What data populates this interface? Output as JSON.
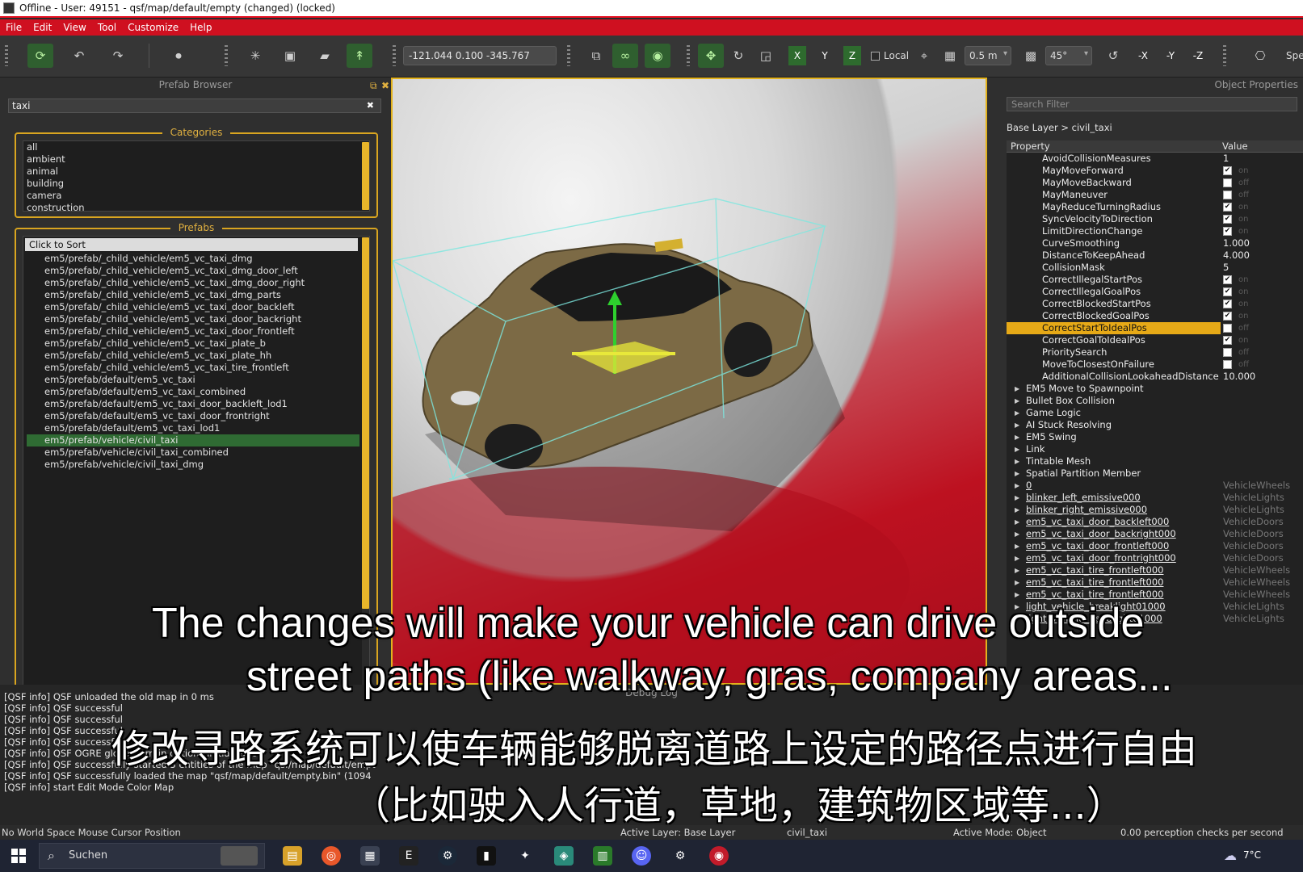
{
  "window": {
    "title": "Offline - User: 49151 - qsf/map/default/empty (changed) (locked)"
  },
  "menu": [
    "File",
    "Edit",
    "View",
    "Tool",
    "Customize",
    "Help"
  ],
  "toolbar": {
    "coordinates": "-121.044 0.100 -345.767",
    "axis_x": "X",
    "axis_y": "Y",
    "axis_z": "Z",
    "local_label": "Local",
    "grid_size": "0.5 m",
    "angle": "45°",
    "neg_x": "-X",
    "neg_y": "-Y",
    "neg_z": "-Z",
    "overflow_label": "Spe"
  },
  "prefab_browser": {
    "title": "Prefab Browser",
    "search_value": "taxi",
    "categories_title": "Categories",
    "categories": [
      "all",
      "ambient",
      "animal",
      "building",
      "camera",
      "construction"
    ],
    "prefabs_title": "Prefabs",
    "sort_label": "Click to Sort",
    "prefabs": [
      "em5/prefab/_child_vehicle/em5_vc_taxi_dmg",
      "em5/prefab/_child_vehicle/em5_vc_taxi_dmg_door_left",
      "em5/prefab/_child_vehicle/em5_vc_taxi_dmg_door_right",
      "em5/prefab/_child_vehicle/em5_vc_taxi_dmg_parts",
      "em5/prefab/_child_vehicle/em5_vc_taxi_door_backleft",
      "em5/prefab/_child_vehicle/em5_vc_taxi_door_backright",
      "em5/prefab/_child_vehicle/em5_vc_taxi_door_frontleft",
      "em5/prefab/_child_vehicle/em5_vc_taxi_plate_b",
      "em5/prefab/_child_vehicle/em5_vc_taxi_plate_hh",
      "em5/prefab/_child_vehicle/em5_vc_taxi_tire_frontleft",
      "em5/prefab/default/em5_vc_taxi",
      "em5/prefab/default/em5_vc_taxi_combined",
      "em5/prefab/default/em5_vc_taxi_door_backleft_lod1",
      "em5/prefab/default/em5_vc_taxi_door_frontright",
      "em5/prefab/default/em5_vc_taxi_lod1",
      "em5/prefab/vehicle/civil_taxi",
      "em5/prefab/vehicle/civil_taxi_combined",
      "em5/prefab/vehicle/civil_taxi_dmg"
    ],
    "selected_prefab": "em5/prefab/vehicle/civil_taxi"
  },
  "object_properties": {
    "title": "Object Properties",
    "search_placeholder": "Search Filter",
    "breadcrumb": "Base Layer > civil_taxi",
    "col_property": "Property",
    "col_value": "Value",
    "rows": [
      {
        "name": "AvoidCollisionMeasures",
        "value": "1"
      },
      {
        "name": "MayMoveForward",
        "check": true,
        "state": "on"
      },
      {
        "name": "MayMoveBackward",
        "check": false,
        "state": "off"
      },
      {
        "name": "MayManeuver",
        "check": false,
        "state": "off"
      },
      {
        "name": "MayReduceTurningRadius",
        "check": true,
        "state": "on"
      },
      {
        "name": "SyncVelocityToDirection",
        "check": true,
        "state": "on"
      },
      {
        "name": "LimitDirectionChange",
        "check": true,
        "state": "on"
      },
      {
        "name": "CurveSmoothing",
        "value": "1.000"
      },
      {
        "name": "DistanceToKeepAhead",
        "value": "4.000"
      },
      {
        "name": "CollisionMask",
        "value": "5"
      },
      {
        "name": "CorrectIllegalStartPos",
        "check": true,
        "state": "on"
      },
      {
        "name": "CorrectIllegalGoalPos",
        "check": true,
        "state": "on"
      },
      {
        "name": "CorrectBlockedStartPos",
        "check": true,
        "state": "on"
      },
      {
        "name": "CorrectBlockedGoalPos",
        "check": true,
        "state": "on"
      },
      {
        "name": "CorrectStartToIdealPos",
        "check": false,
        "state": "off",
        "selected": true
      },
      {
        "name": "CorrectGoalToIdealPos",
        "check": true,
        "state": "on"
      },
      {
        "name": "PrioritySearch",
        "check": false,
        "state": "off"
      },
      {
        "name": "MoveToClosestOnFailure",
        "check": false,
        "state": "off"
      },
      {
        "name": "AdditionalCollisionLookaheadDistance",
        "value": "10.000"
      }
    ],
    "sections": [
      "EM5 Move to Spawnpoint",
      "Bullet Box Collision",
      "Game Logic",
      "AI Stuck Resolving",
      "EM5 Swing",
      "Link",
      "Tintable Mesh",
      "Spatial Partition Member"
    ],
    "children": [
      {
        "name": "0",
        "type": "VehicleWheels"
      },
      {
        "name": "blinker_left_emissive000",
        "type": "VehicleLights"
      },
      {
        "name": "blinker_right_emissive000",
        "type": "VehicleLights"
      },
      {
        "name": "em5_vc_taxi_door_backleft000",
        "type": "VehicleDoors"
      },
      {
        "name": "em5_vc_taxi_door_backright000",
        "type": "VehicleDoors"
      },
      {
        "name": "em5_vc_taxi_door_frontleft000",
        "type": "VehicleDoors"
      },
      {
        "name": "em5_vc_taxi_door_frontright000",
        "type": "VehicleDoors"
      },
      {
        "name": "em5_vc_taxi_tire_frontleft000",
        "type": "VehicleWheels"
      },
      {
        "name": "em5_vc_taxi_tire_frontleft000",
        "type": "VehicleWheels"
      },
      {
        "name": "em5_vc_taxi_tire_frontleft000",
        "type": "VehicleWheels"
      },
      {
        "name": "light_vehicle_breaklight01000",
        "type": "VehicleLights"
      },
      {
        "name": "light_vehicle_headlight01000",
        "type": "VehicleLights"
      }
    ]
  },
  "debug_log": {
    "title": "Debug Log",
    "lines": [
      "[QSF info] QSF unloaded the old map in 0 ms",
      "[QSF info] QSF successful",
      "[QSF info] QSF successful",
      "[QSF info] QSF successful",
      "[QSF info] QSF successful",
      "[QSF info] QSF OGRE global terrain options initialization",
      "[QSF info] QSF successfully started 3 entities of the map \"qsf/map/default/empt",
      "[QSF info] QSF successfully loaded the map \"qsf/map/default/empty.bin\" (1094",
      "[QSF info] start Edit Mode Color Map"
    ]
  },
  "status": {
    "mouse": "No World Space Mouse Cursor Position",
    "layer": "Active Layer: Base Layer",
    "object": "civil_taxi",
    "mode": "Active Mode: Object",
    "perception": "0.00 perception checks per second"
  },
  "taskbar": {
    "search": "Suchen",
    "weather": "7°C"
  },
  "subtitles": {
    "en_line1": "The changes will make your vehicle can drive outside",
    "en_line2": "street paths (like walkway, gras, company areas...",
    "zh_line1": "修改寻路系统可以使车辆能够脱离道路上设定的路径点进行自由",
    "zh_line2": "（比如驶入人行道，草地，建筑物区域等...）"
  },
  "colors": {
    "accent": "#e2b21d",
    "menu": "#cf1020",
    "selection_green": "#2f6b33"
  }
}
